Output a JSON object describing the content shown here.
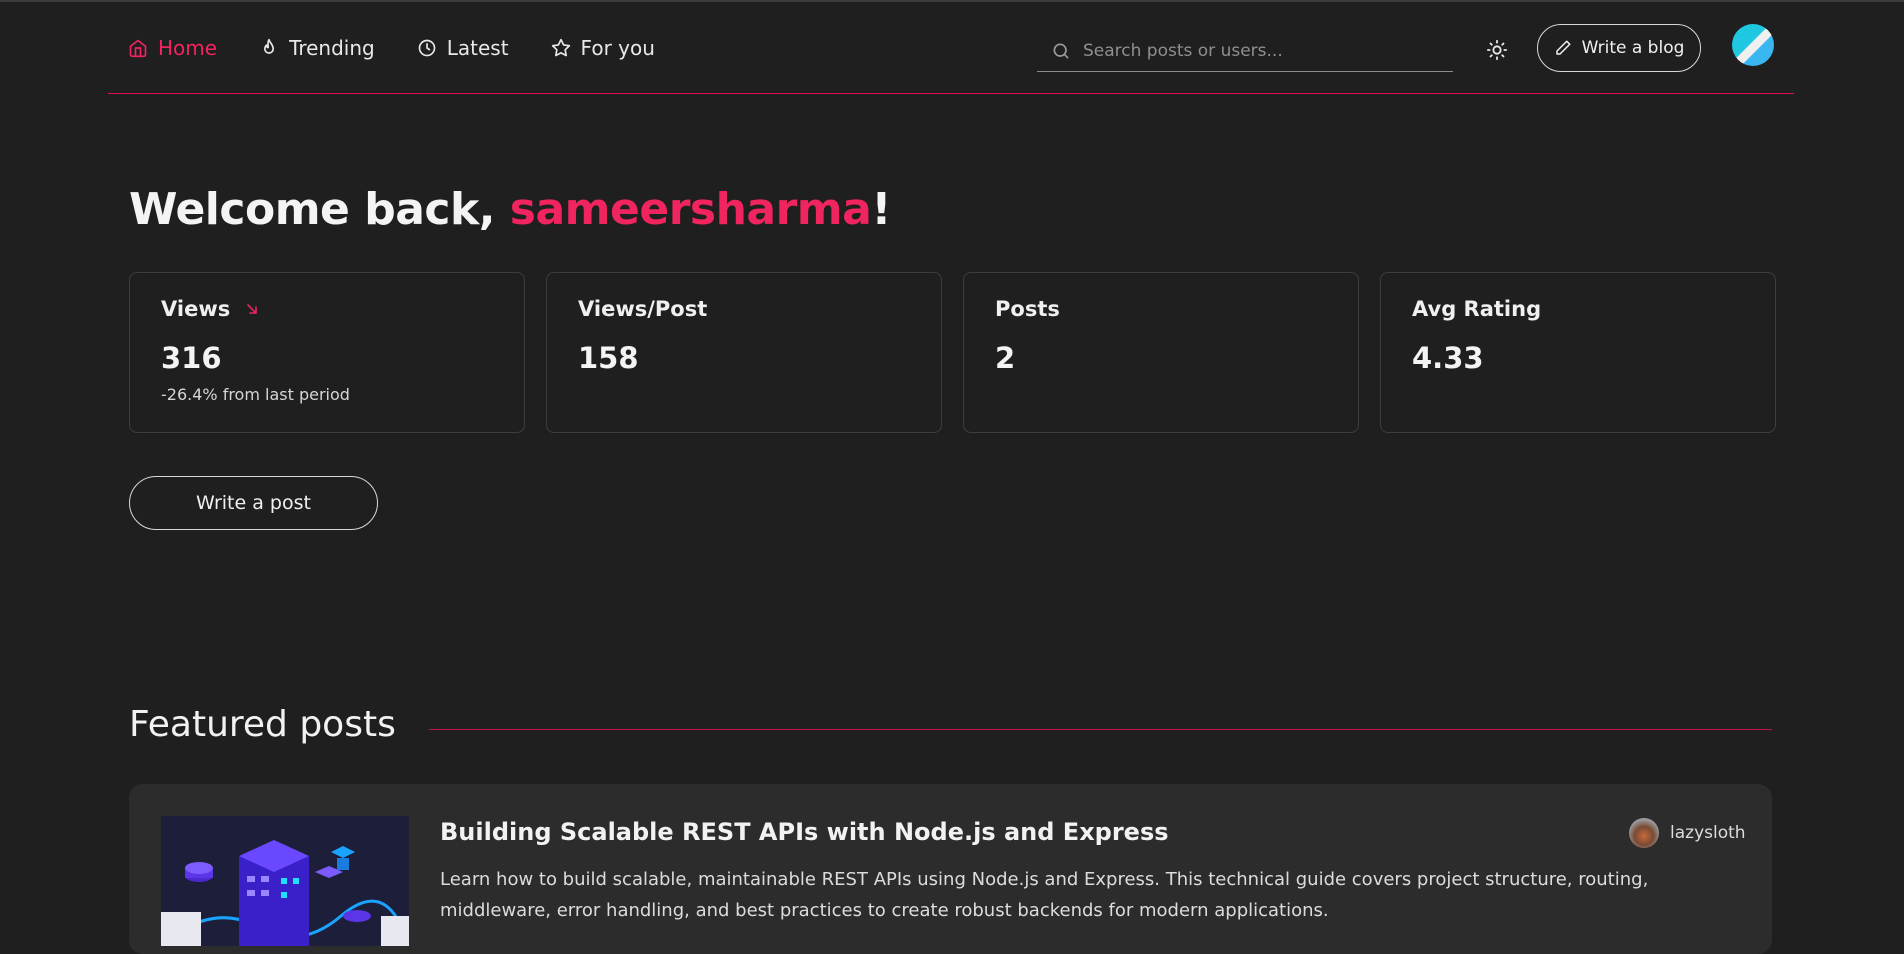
{
  "nav": {
    "items": [
      {
        "label": "Home",
        "icon": "home-icon",
        "active": true
      },
      {
        "label": "Trending",
        "icon": "flame-icon",
        "active": false
      },
      {
        "label": "Latest",
        "icon": "clock-icon",
        "active": false
      },
      {
        "label": "For you",
        "icon": "star-icon",
        "active": false
      }
    ]
  },
  "search": {
    "placeholder": "Search posts or users...",
    "icon": "search-icon"
  },
  "header": {
    "write_blog_label": "Write a blog",
    "theme_icon": "sun-icon"
  },
  "colors": {
    "accent": "#f0245e",
    "background": "#1f1f1f",
    "card": "#2c2c2c"
  },
  "welcome": {
    "prefix": "Welcome back, ",
    "username": "sameersharma",
    "suffix": "!"
  },
  "stats": [
    {
      "title": "Views",
      "value": "316",
      "delta": "-26.4% from last period",
      "trend_icon": "trend-down-icon"
    },
    {
      "title": "Views/Post",
      "value": "158",
      "delta": ""
    },
    {
      "title": "Posts",
      "value": "2",
      "delta": ""
    },
    {
      "title": "Avg Rating",
      "value": "4.33",
      "delta": ""
    }
  ],
  "write_post_label": "Write a post",
  "featured": {
    "heading": "Featured posts",
    "posts": [
      {
        "title": "Building Scalable REST APIs with Node.js and Express",
        "description": "Learn how to build scalable, maintainable REST APIs using Node.js and Express. This technical guide covers project structure, routing, middleware, error handling, and best practices to create robust backends for modern applications.",
        "author": "lazysloth"
      }
    ]
  }
}
